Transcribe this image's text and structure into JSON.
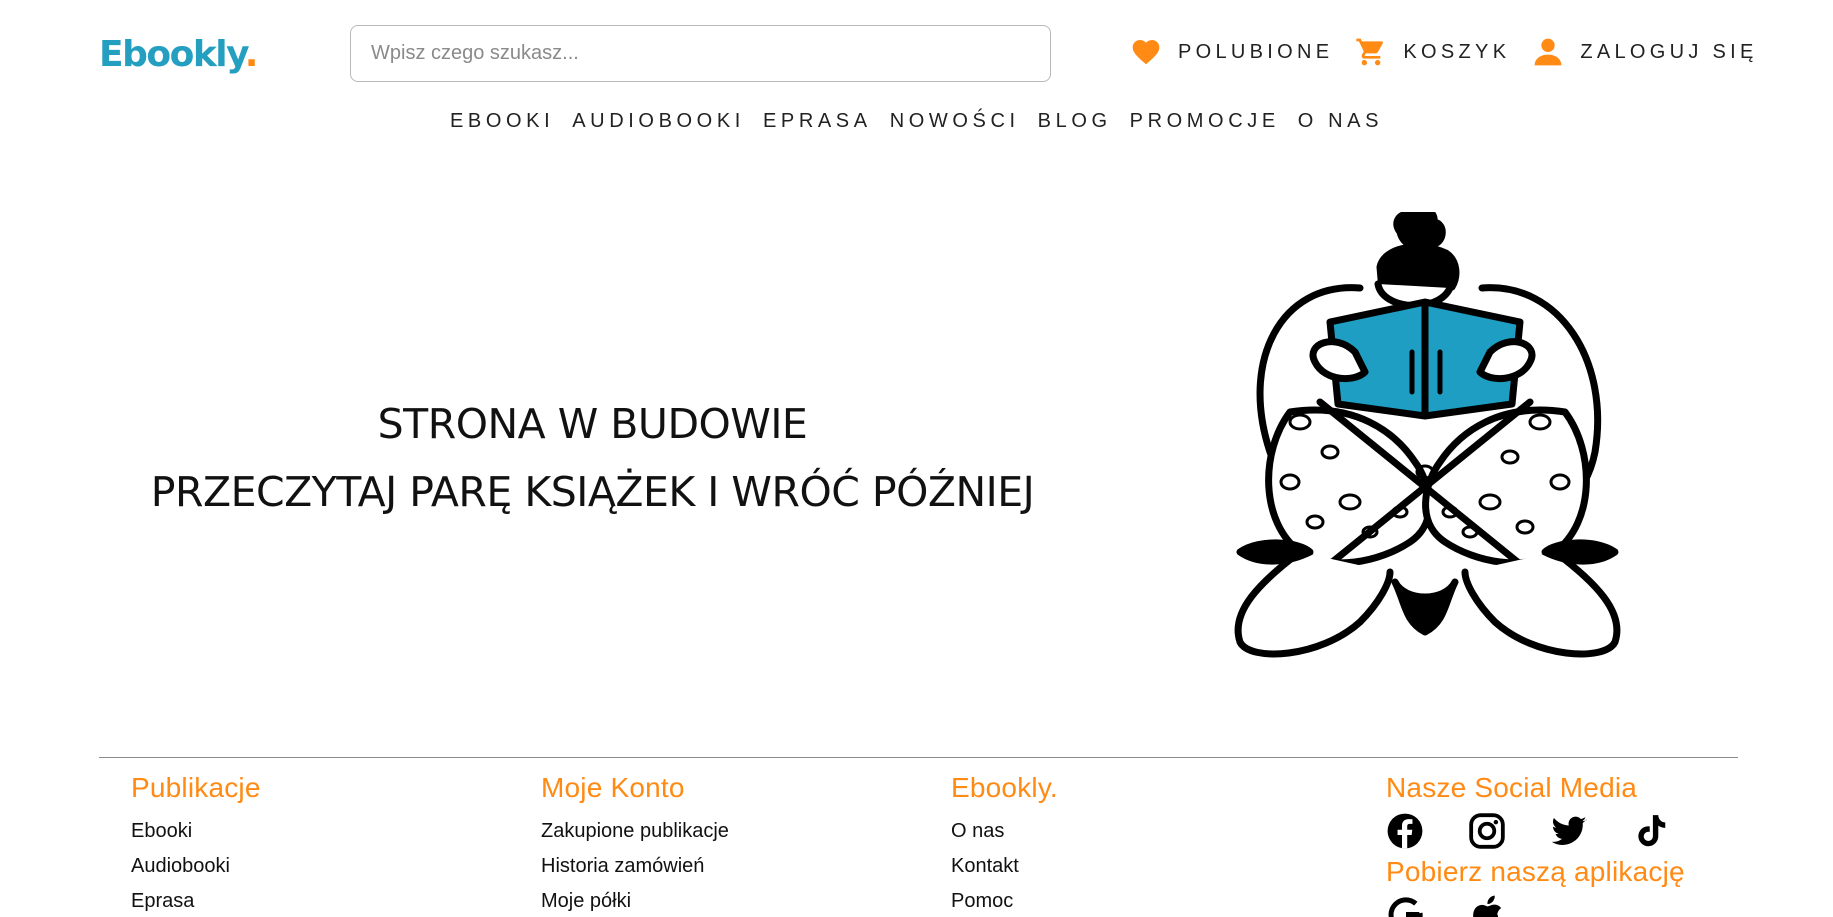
{
  "brand": {
    "name": "Ebookly",
    "dot": ".",
    "primary_color": "#259fc0",
    "accent_color": "#ff8a14"
  },
  "search": {
    "placeholder": "Wpisz czego szukasz..."
  },
  "user_links": [
    {
      "icon": "heart-icon",
      "label": "POLUBIONE"
    },
    {
      "icon": "cart-icon",
      "label": "KOSZYK"
    },
    {
      "icon": "user-icon",
      "label": "ZALOGUJ SIĘ"
    }
  ],
  "nav": [
    "EBOOKI",
    "AUDIOBOOKI",
    "EPRASA",
    "NOWOŚCI",
    "BLOG",
    "PROMOCJE",
    "O NAS"
  ],
  "hero": {
    "line1": "STRONA W BUDOWIE",
    "line2": "PRZECZYTAJ PARĘ KSIĄŻEK I WRÓĆ PÓŹNIEJ",
    "illustration": "person-reading-book-illustration"
  },
  "footer": {
    "publications": {
      "title": "Publikacje",
      "links": [
        "Ebooki",
        "Audiobooki",
        "Eprasa"
      ]
    },
    "account": {
      "title": "Moje Konto",
      "links": [
        "Zakupione publikacje",
        "Historia zamówień",
        "Moje półki"
      ]
    },
    "company": {
      "title": "Ebookly.",
      "links": [
        "O nas",
        "Kontakt",
        "Pomoc"
      ]
    },
    "social": {
      "title": "Nasze Social Media",
      "icons": [
        "facebook-icon",
        "instagram-icon",
        "twitter-icon",
        "tiktok-icon"
      ],
      "app_title": "Pobierz naszą aplikację",
      "app_icons": [
        "google-play-icon",
        "apple-icon"
      ]
    }
  }
}
